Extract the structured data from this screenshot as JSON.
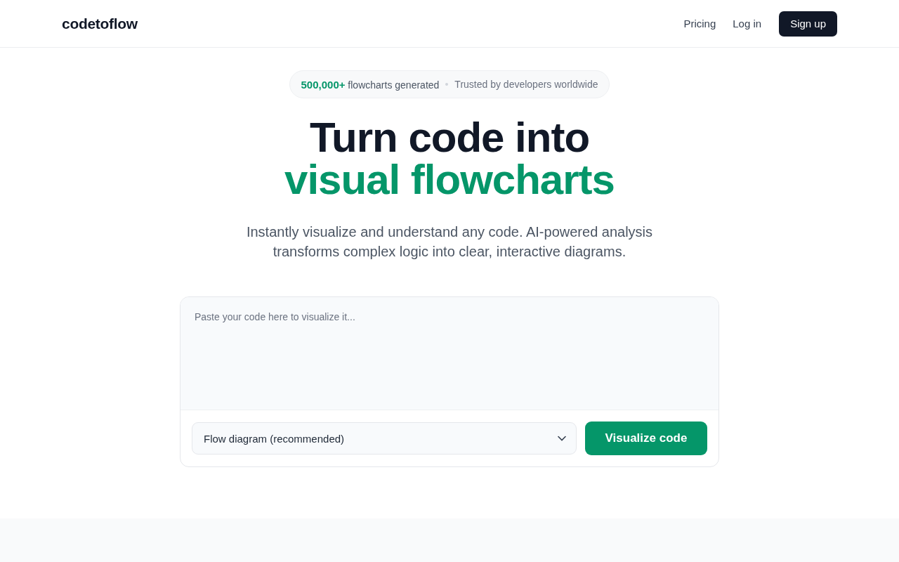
{
  "header": {
    "logo": "codetoflow",
    "nav": [
      "Pricing",
      "Log in"
    ],
    "cta": "Sign up"
  },
  "badge": {
    "stat": "**500,000+** flowcharts generated",
    "note": "Trusted by developers worldwide"
  },
  "hero": {
    "title_line_1": "Turn code into",
    "title_line_2": "visual flowcharts",
    "subtitle": "Instantly visualize and understand any code. AI-powered analysis transforms complex logic into clear, interactive diagrams."
  },
  "editor": {
    "placeholder": "Paste your code here to visualize it...",
    "diagram_type": "Flow diagram (recommended)",
    "submit": "Visualize code"
  }
}
